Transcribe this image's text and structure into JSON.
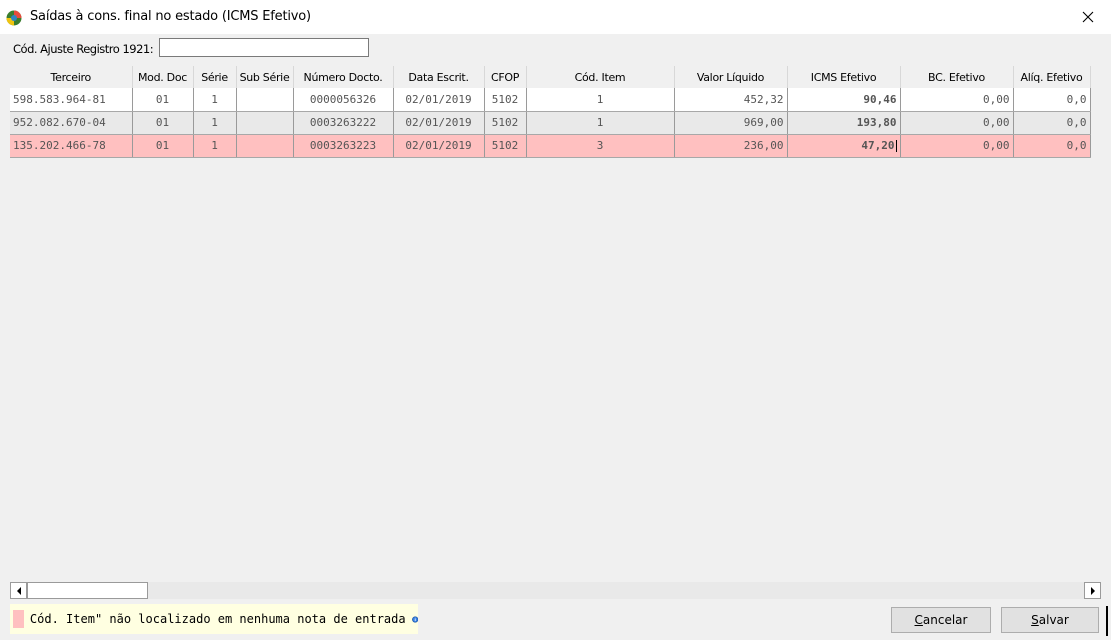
{
  "window": {
    "title": "Saídas à cons. final no estado (ICMS Efetivo)"
  },
  "form": {
    "ajuste_label": "Cód. Ajuste Registro 1921:",
    "ajuste_value": ""
  },
  "grid": {
    "columns": [
      "Terceiro",
      "Mod. Doc",
      "Série",
      "Sub Série",
      "Número Docto.",
      "Data Escrit.",
      "CFOP",
      "Cód. Item",
      "Valor Líquido",
      "ICMS Efetivo",
      "BC. Efetivo",
      "Alíq. Efetivo"
    ],
    "rows": [
      {
        "terceiro": "598.583.964-81",
        "mod_doc": "01",
        "serie": "1",
        "sub_serie": "",
        "numero": "0000056326",
        "data": "02/01/2019",
        "cfop": "5102",
        "cod_item": "1",
        "valor_liquido": "452,32",
        "icms_efetivo": "90,46",
        "bc_efetivo": "0,00",
        "aliq_efetivo": "0,0",
        "highlight": "none"
      },
      {
        "terceiro": "952.082.670-04",
        "mod_doc": "01",
        "serie": "1",
        "sub_serie": "",
        "numero": "0003263222",
        "data": "02/01/2019",
        "cfop": "5102",
        "cod_item": "1",
        "valor_liquido": "969,00",
        "icms_efetivo": "193,80",
        "bc_efetivo": "0,00",
        "aliq_efetivo": "0,0",
        "highlight": "none"
      },
      {
        "terceiro": "135.202.466-78",
        "mod_doc": "01",
        "serie": "1",
        "sub_serie": "",
        "numero": "0003263223",
        "data": "02/01/2019",
        "cfop": "5102",
        "cod_item": "3",
        "valor_liquido": "236,00",
        "icms_efetivo": "47,20",
        "bc_efetivo": "0,00",
        "aliq_efetivo": "0,0",
        "highlight": "not-found"
      }
    ]
  },
  "legend": {
    "text": "Cód. Item\" não localizado em nenhuma nota de entrada",
    "color": "#ffc0c0",
    "background": "#ffffe1"
  },
  "buttons": {
    "cancel": "Cancelar",
    "save": "Salvar"
  }
}
